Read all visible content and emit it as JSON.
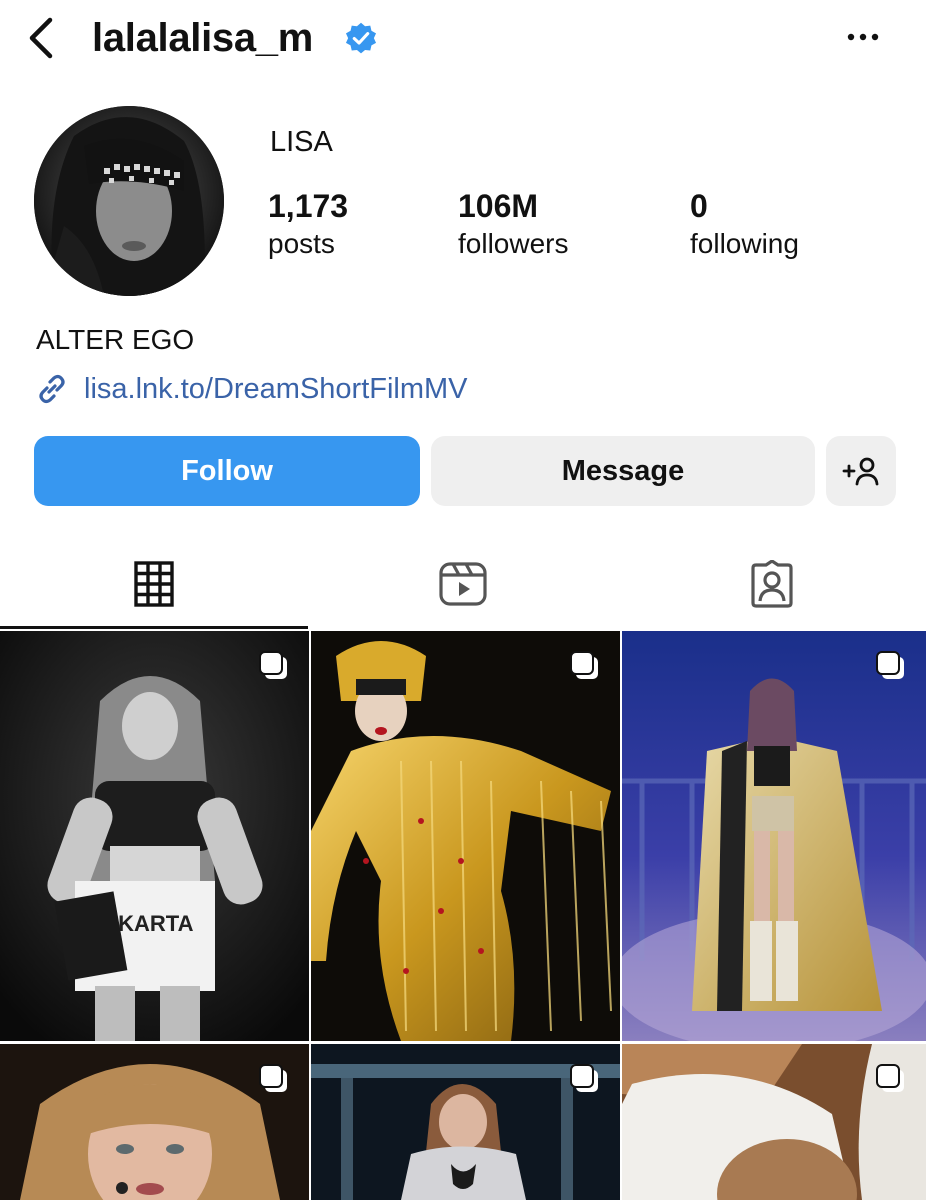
{
  "header": {
    "username": "lalalalisa_m",
    "back_icon": "chevron-left-icon",
    "verified_icon": "verified-badge-icon",
    "more_icon": "more-horizontal-icon"
  },
  "profile": {
    "display_name": "LISA",
    "stats": [
      {
        "value": "1,173",
        "label": "posts"
      },
      {
        "value": "106M",
        "label": "followers"
      },
      {
        "value": "0",
        "label": "following"
      }
    ],
    "bio": "ALTER EGO",
    "link": "lisa.lnk.to/DreamShortFilmMV"
  },
  "actions": {
    "follow_label": "Follow",
    "message_label": "Message",
    "suggest_icon": "add-person-icon"
  },
  "tabs": [
    {
      "name": "posts-grid",
      "icon": "grid-icon",
      "selected": true
    },
    {
      "name": "reels",
      "icon": "reels-icon",
      "selected": false
    },
    {
      "name": "tagged",
      "icon": "tagged-person-icon",
      "selected": false
    }
  ],
  "colors": {
    "follow_button": "#3797f0",
    "verified_badge": "#3797f0",
    "link": "#3a63a8",
    "secondary_button": "#efefef"
  },
  "posts": [
    {
      "subject": "black-and-white photo in JAKARTA jersey",
      "multi": true
    },
    {
      "subject": "gold sequin costume with headdress",
      "multi": true
    },
    {
      "subject": "concert stage in gold cape",
      "multi": true
    },
    {
      "subject": "portrait with headset microphone",
      "multi": true
    },
    {
      "subject": "back view on stage",
      "multi": true
    },
    {
      "subject": "portrait with white pillow",
      "multi": true
    }
  ]
}
